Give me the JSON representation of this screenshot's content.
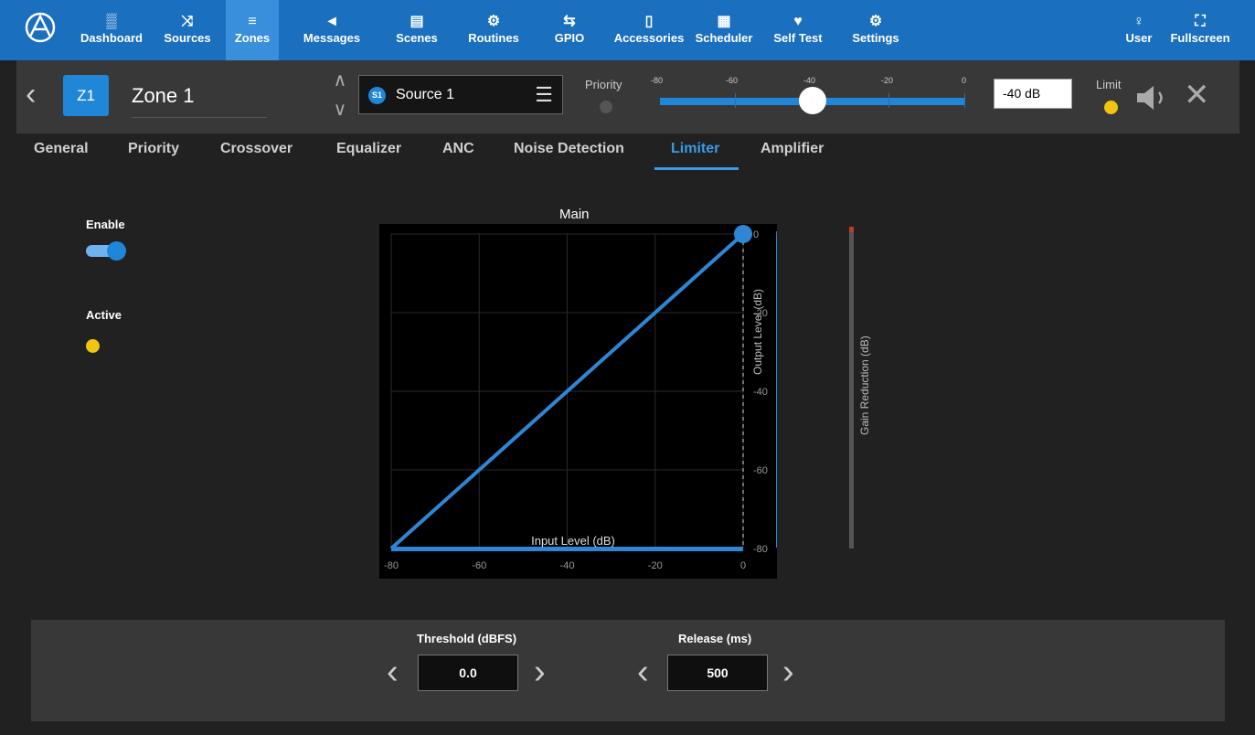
{
  "nav": {
    "items": [
      {
        "label": "Dashboard",
        "icon": "dashboard-icon"
      },
      {
        "label": "Sources",
        "icon": "shuffle-icon"
      },
      {
        "label": "Zones",
        "icon": "layers-icon"
      },
      {
        "label": "Messages",
        "icon": "megaphone-icon"
      },
      {
        "label": "Scenes",
        "icon": "clapperboard-icon"
      },
      {
        "label": "Routines",
        "icon": "gears-icon"
      },
      {
        "label": "GPIO",
        "icon": "gpio-icon"
      },
      {
        "label": "Accessories",
        "icon": "tablet-icon"
      },
      {
        "label": "Scheduler",
        "icon": "calendar-icon"
      },
      {
        "label": "Self Test",
        "icon": "heart-test-icon"
      },
      {
        "label": "Settings",
        "icon": "gear-icon"
      },
      {
        "label": "User",
        "icon": "user-icon"
      },
      {
        "label": "Fullscreen",
        "icon": "fullscreen-icon"
      }
    ],
    "active": "Zones",
    "accent": "#1a6fbf"
  },
  "zone": {
    "badge": "Z1",
    "name": "Zone 1",
    "source_badge": "S1",
    "source_name": "Source 1",
    "priority_label": "Priority",
    "volume_ticks": [
      "-80",
      "-60",
      "-40",
      "-20",
      "0"
    ],
    "volume_db": -40,
    "volume_text": "-40 dB",
    "limit_label": "Limit"
  },
  "tabs": [
    "General",
    "Priority",
    "Crossover",
    "Equalizer",
    "ANC",
    "Noise Detection",
    "Limiter",
    "Amplifier"
  ],
  "active_tab": "Limiter",
  "limiter": {
    "enable_label": "Enable",
    "enabled": true,
    "active_label": "Active",
    "threshold_label": "Threshold (dBFS)",
    "threshold_value": "0.0",
    "release_label": "Release (ms)",
    "release_value": "500"
  },
  "chart_data": {
    "type": "line",
    "title": "Main",
    "xlabel": "Input Level (dB)",
    "ylabel": "Output Level (dB)",
    "y2label": "Gain Reduction (dB)",
    "xlim": [
      -80,
      0
    ],
    "ylim": [
      -80,
      0
    ],
    "x_ticks": [
      "-80",
      "-60",
      "-40",
      "-20",
      "0"
    ],
    "y_ticks": [
      "0",
      "-20",
      "-40",
      "-60",
      "-80"
    ],
    "series": [
      {
        "x": [
          -80,
          0
        ],
        "y": [
          -80,
          0
        ]
      }
    ],
    "threshold": 0,
    "grid": true,
    "line_color": "#2e86d4"
  }
}
